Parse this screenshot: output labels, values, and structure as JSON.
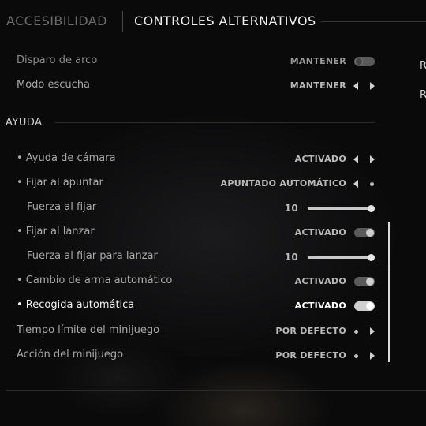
{
  "header": {
    "tab_inactive": "ACCESIBILIDAD",
    "tab_active": "CONTROLES ALTERNATIVOS"
  },
  "side_panel": {
    "letter1": "R",
    "letter2": "R"
  },
  "section": {
    "title": "AYUDA"
  },
  "rows": [
    {
      "label": "Disparo de arco",
      "value": "MANTENER",
      "control": "toggle",
      "state": "off"
    },
    {
      "label": "Modo escucha",
      "value": "MANTENER",
      "control": "arrows"
    },
    {
      "label": "• Ayuda de cámara",
      "value": "ACTIVADO",
      "control": "arrows"
    },
    {
      "label": "• Fijar al apuntar",
      "value": "APUNTADO AUTOMÁTICO",
      "control": "arrow-left-dot"
    },
    {
      "label": "Fuerza al fijar",
      "value": "10",
      "control": "slider",
      "level": 1.0
    },
    {
      "label": "• Fijar al lanzar",
      "value": "ACTIVADO",
      "control": "toggle",
      "state": "on"
    },
    {
      "label": "Fuerza al fijar para lanzar",
      "value": "10",
      "control": "slider",
      "level": 1.0
    },
    {
      "label": "• Cambio de arma automático",
      "value": "ACTIVADO",
      "control": "toggle",
      "state": "on"
    },
    {
      "label": "• Recogida automática",
      "value": "ACTIVADO",
      "control": "toggle",
      "state": "on",
      "selected": true
    },
    {
      "label": "Tiempo límite del minijuego",
      "value": "POR DEFECTO",
      "control": "dot-arrow-right"
    },
    {
      "label": "Acción del minijuego",
      "value": "POR DEFECTO",
      "control": "dot-arrow-right"
    }
  ],
  "icons": {
    "left": "arrow-left-icon",
    "right": "arrow-right-icon",
    "dot": "dot-icon"
  }
}
